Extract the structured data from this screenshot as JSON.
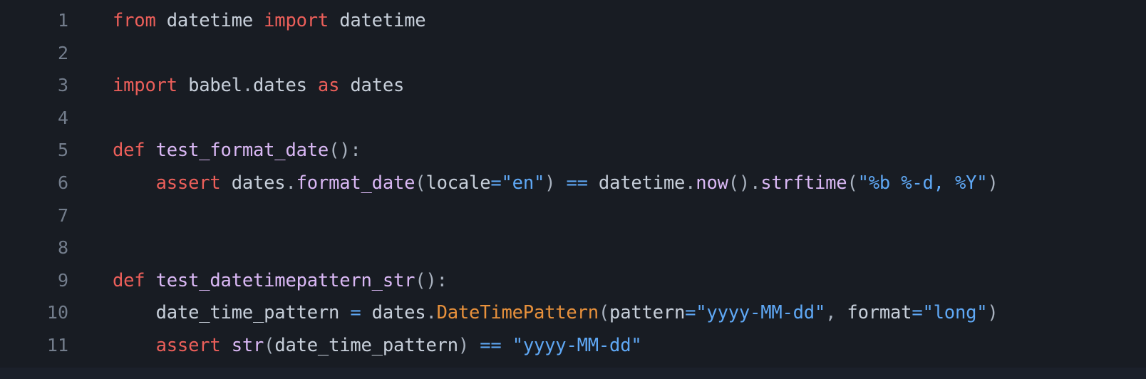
{
  "editor": {
    "language": "python",
    "theme_name": "dark",
    "background_color": "#181c23",
    "gutter_text_color": "#737d8c",
    "bottom_bar_color": "#1b202a",
    "colors": {
      "keyword": "#ec5f5a",
      "identifier": "#c7cfda",
      "function": "#dab8f5",
      "class": "#e8913c",
      "string": "#5fa8f5",
      "operator": "#5fa8f5",
      "punctuation": "#a9b2bf"
    },
    "lines": [
      {
        "number": "1",
        "tokens": [
          {
            "t": "from",
            "c": "kw"
          },
          {
            "t": " ",
            "c": "plain"
          },
          {
            "t": "datetime",
            "c": "plain"
          },
          {
            "t": " ",
            "c": "plain"
          },
          {
            "t": "import",
            "c": "kw"
          },
          {
            "t": " ",
            "c": "plain"
          },
          {
            "t": "datetime",
            "c": "plain"
          }
        ]
      },
      {
        "number": "2",
        "tokens": []
      },
      {
        "number": "3",
        "tokens": [
          {
            "t": "import",
            "c": "kw"
          },
          {
            "t": " ",
            "c": "plain"
          },
          {
            "t": "babel",
            "c": "plain"
          },
          {
            "t": ".",
            "c": "punct"
          },
          {
            "t": "dates",
            "c": "plain"
          },
          {
            "t": " ",
            "c": "plain"
          },
          {
            "t": "as",
            "c": "kw"
          },
          {
            "t": " ",
            "c": "plain"
          },
          {
            "t": "dates",
            "c": "plain"
          }
        ]
      },
      {
        "number": "4",
        "tokens": []
      },
      {
        "number": "5",
        "tokens": [
          {
            "t": "def",
            "c": "kw"
          },
          {
            "t": " ",
            "c": "plain"
          },
          {
            "t": "test_format_date",
            "c": "func"
          },
          {
            "t": "()",
            "c": "punct"
          },
          {
            "t": ":",
            "c": "punct"
          }
        ]
      },
      {
        "number": "6",
        "tokens": [
          {
            "t": "    ",
            "c": "plain"
          },
          {
            "t": "assert",
            "c": "kw"
          },
          {
            "t": " ",
            "c": "plain"
          },
          {
            "t": "dates",
            "c": "plain"
          },
          {
            "t": ".",
            "c": "punct"
          },
          {
            "t": "format_date",
            "c": "func"
          },
          {
            "t": "(",
            "c": "punct"
          },
          {
            "t": "locale",
            "c": "plain"
          },
          {
            "t": "=",
            "c": "op"
          },
          {
            "t": "\"en\"",
            "c": "str"
          },
          {
            "t": ")",
            "c": "punct"
          },
          {
            "t": " ",
            "c": "plain"
          },
          {
            "t": "==",
            "c": "op"
          },
          {
            "t": " ",
            "c": "plain"
          },
          {
            "t": "datetime",
            "c": "plain"
          },
          {
            "t": ".",
            "c": "punct"
          },
          {
            "t": "now",
            "c": "func"
          },
          {
            "t": "()",
            "c": "punct"
          },
          {
            "t": ".",
            "c": "punct"
          },
          {
            "t": "strftime",
            "c": "func"
          },
          {
            "t": "(",
            "c": "punct"
          },
          {
            "t": "\"%b %-d, %Y\"",
            "c": "str"
          },
          {
            "t": ")",
            "c": "punct"
          }
        ]
      },
      {
        "number": "7",
        "tokens": []
      },
      {
        "number": "8",
        "tokens": []
      },
      {
        "number": "9",
        "tokens": [
          {
            "t": "def",
            "c": "kw"
          },
          {
            "t": " ",
            "c": "plain"
          },
          {
            "t": "test_datetimepattern_str",
            "c": "func"
          },
          {
            "t": "()",
            "c": "punct"
          },
          {
            "t": ":",
            "c": "punct"
          }
        ]
      },
      {
        "number": "10",
        "tokens": [
          {
            "t": "    ",
            "c": "plain"
          },
          {
            "t": "date_time_pattern",
            "c": "plain"
          },
          {
            "t": " ",
            "c": "plain"
          },
          {
            "t": "=",
            "c": "op"
          },
          {
            "t": " ",
            "c": "plain"
          },
          {
            "t": "dates",
            "c": "plain"
          },
          {
            "t": ".",
            "c": "punct"
          },
          {
            "t": "DateTimePattern",
            "c": "class"
          },
          {
            "t": "(",
            "c": "punct"
          },
          {
            "t": "pattern",
            "c": "plain"
          },
          {
            "t": "=",
            "c": "op"
          },
          {
            "t": "\"yyyy-MM-dd\"",
            "c": "str"
          },
          {
            "t": ",",
            "c": "punct"
          },
          {
            "t": " ",
            "c": "plain"
          },
          {
            "t": "format",
            "c": "plain"
          },
          {
            "t": "=",
            "c": "op"
          },
          {
            "t": "\"long\"",
            "c": "str"
          },
          {
            "t": ")",
            "c": "punct"
          }
        ]
      },
      {
        "number": "11",
        "tokens": [
          {
            "t": "    ",
            "c": "plain"
          },
          {
            "t": "assert",
            "c": "kw"
          },
          {
            "t": " ",
            "c": "plain"
          },
          {
            "t": "str",
            "c": "func"
          },
          {
            "t": "(",
            "c": "punct"
          },
          {
            "t": "date_time_pattern",
            "c": "plain"
          },
          {
            "t": ")",
            "c": "punct"
          },
          {
            "t": " ",
            "c": "plain"
          },
          {
            "t": "==",
            "c": "op"
          },
          {
            "t": " ",
            "c": "plain"
          },
          {
            "t": "\"yyyy-MM-dd\"",
            "c": "str"
          }
        ]
      }
    ]
  }
}
